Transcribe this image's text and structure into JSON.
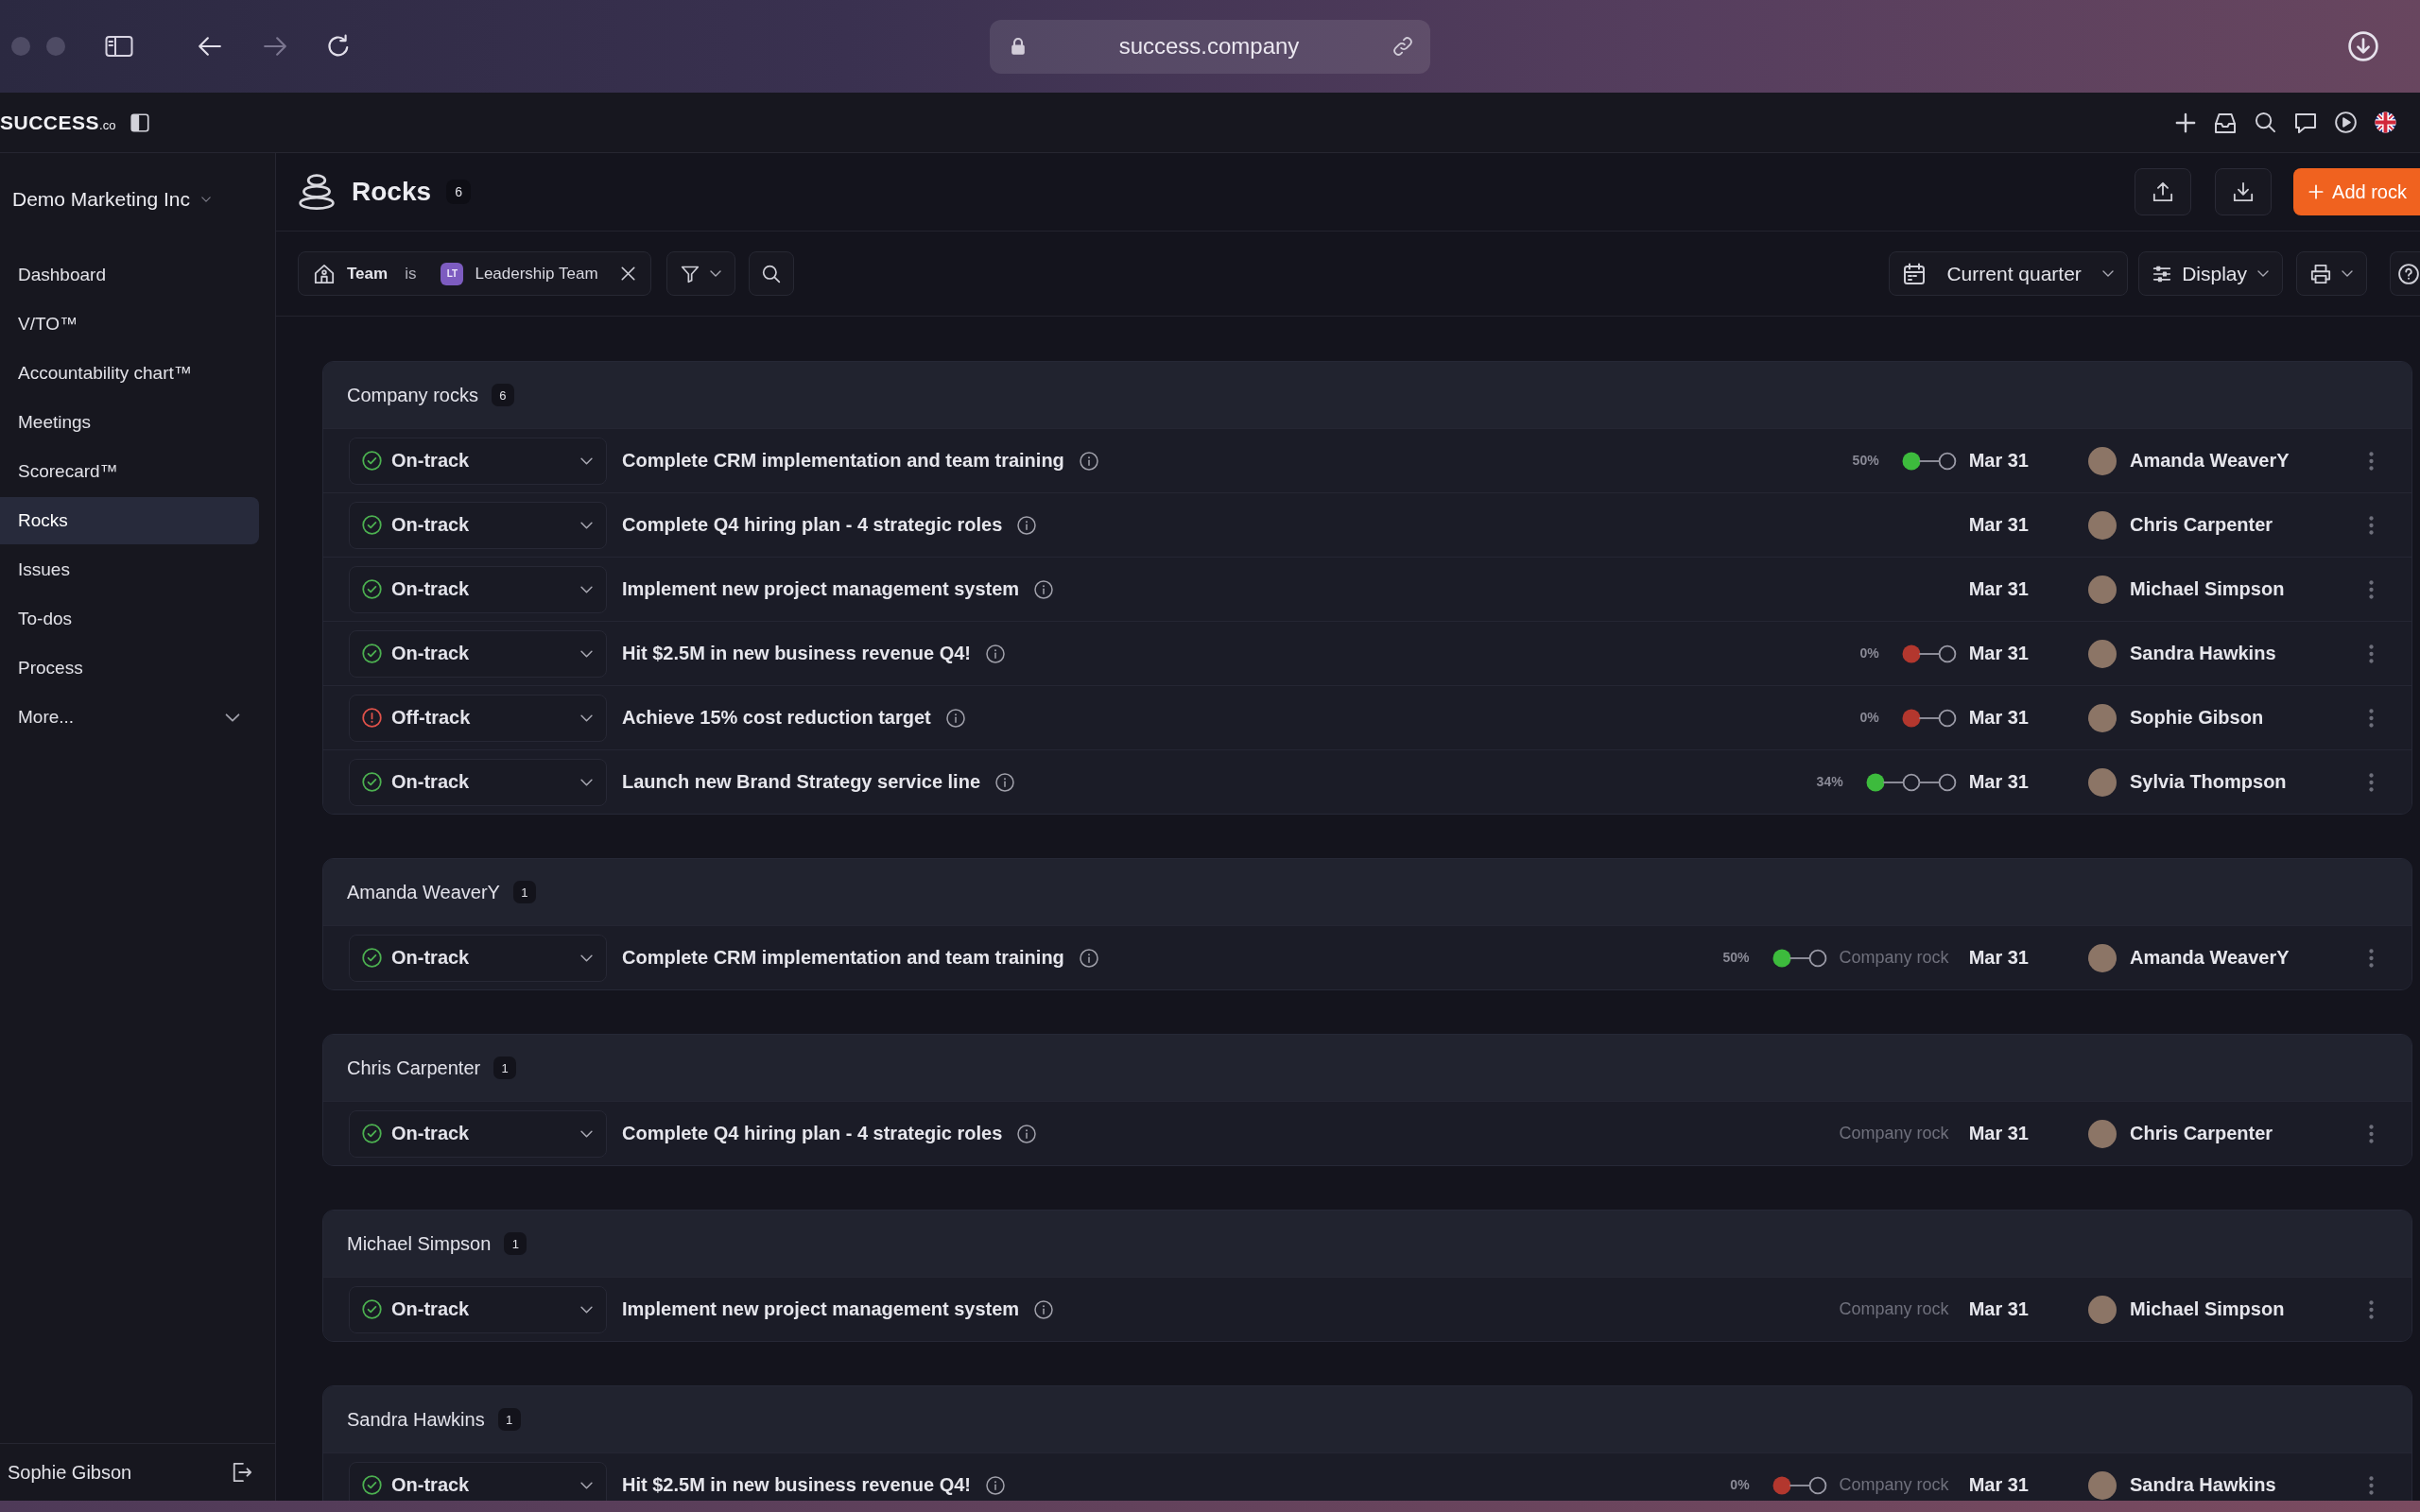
{
  "browser": {
    "url": "success.company"
  },
  "app_bar": {
    "logo": "SUCCESS$_{.co}$"
  },
  "sidebar": {
    "workspace": "Demo Marketing Inc",
    "items": [
      {
        "label": "Dashboard",
        "selected": false
      },
      {
        "label": "V/TO™",
        "selected": false
      },
      {
        "label": "Accountability chart™",
        "selected": false
      },
      {
        "label": "Meetings",
        "selected": false
      },
      {
        "label": "Scorecard™",
        "selected": false
      },
      {
        "label": "Rocks",
        "selected": true
      },
      {
        "label": "Issues",
        "selected": false
      },
      {
        "label": "To-dos",
        "selected": false
      },
      {
        "label": "Process",
        "selected": false
      }
    ],
    "more": {
      "label": "More...",
      "expanded": false
    },
    "user": "Sophie Gibson"
  },
  "header": {
    "title": "Rocks",
    "count": "6",
    "add_button": "Add rock"
  },
  "filters": {
    "field": "Team",
    "operator": "is",
    "team": {
      "initials": "LT",
      "name": "Leadership Team"
    },
    "period": "Current quarter",
    "display": "Display"
  },
  "groups": [
    {
      "title": "Company rocks",
      "count": "6",
      "rows": [
        {
          "off_track": false,
          "status_label": "On-track",
          "title": "Complete CRM implementation and team training",
          "progress": "50%",
          "milestones": [
            {
              "done": true,
              "overdue": false
            },
            {
              "done": false,
              "overdue": false
            }
          ],
          "due": "Mar 31",
          "owner": "Amanda WeaverY"
        },
        {
          "off_track": false,
          "status_label": "On-track",
          "title": "Complete Q4 hiring plan - 4 strategic roles",
          "due": "Mar 31",
          "owner": "Chris Carpenter"
        },
        {
          "off_track": false,
          "status_label": "On-track",
          "title": "Implement new project management system",
          "due": "Mar 31",
          "owner": "Michael Simpson"
        },
        {
          "off_track": false,
          "status_label": "On-track",
          "title": "Hit $2.5M in new business revenue Q4!",
          "progress": "0%",
          "milestones": [
            {
              "done": false,
              "overdue": true
            },
            {
              "done": false,
              "overdue": false
            }
          ],
          "due": "Mar 31",
          "owner": "Sandra Hawkins"
        },
        {
          "off_track": true,
          "status_label": "Off-track",
          "title": "Achieve 15% cost reduction target",
          "progress": "0%",
          "milestones": [
            {
              "done": false,
              "overdue": true
            },
            {
              "done": false,
              "overdue": false
            }
          ],
          "due": "Mar 31",
          "owner": "Sophie Gibson"
        },
        {
          "off_track": false,
          "status_label": "On-track",
          "title": "Launch new Brand Strategy service line",
          "progress": "34%",
          "milestones": [
            {
              "done": true,
              "overdue": false
            },
            {
              "done": false,
              "overdue": false
            },
            {
              "done": false,
              "overdue": false
            }
          ],
          "due": "Mar 31",
          "owner": "Sylvia Thompson"
        }
      ]
    },
    {
      "title": "Amanda WeaverY",
      "count": "1",
      "rows": [
        {
          "off_track": false,
          "status_label": "On-track",
          "title": "Complete CRM implementation and team training",
          "progress": "50%",
          "milestones": [
            {
              "done": true,
              "overdue": false
            },
            {
              "done": false,
              "overdue": false
            }
          ],
          "tag": "Company rock",
          "due": "Mar 31",
          "owner": "Amanda WeaverY"
        }
      ]
    },
    {
      "title": "Chris Carpenter",
      "count": "1",
      "rows": [
        {
          "off_track": false,
          "status_label": "On-track",
          "title": "Complete Q4 hiring plan - 4 strategic roles",
          "tag": "Company rock",
          "due": "Mar 31",
          "owner": "Chris Carpenter"
        }
      ]
    },
    {
      "title": "Michael Simpson",
      "count": "1",
      "rows": [
        {
          "off_track": false,
          "status_label": "On-track",
          "title": "Implement new project management system",
          "tag": "Company rock",
          "due": "Mar 31",
          "owner": "Michael Simpson"
        }
      ]
    },
    {
      "title": "Sandra Hawkins",
      "count": "1",
      "rows": [
        {
          "off_track": false,
          "status_label": "On-track",
          "title": "Hit $2.5M in new business revenue Q4!",
          "progress": "0%",
          "milestones": [
            {
              "done": false,
              "overdue": true
            },
            {
              "done": false,
              "overdue": false
            }
          ],
          "tag": "Company rock",
          "due": "Mar 31",
          "owner": "Sandra Hawkins"
        }
      ]
    }
  ]
}
